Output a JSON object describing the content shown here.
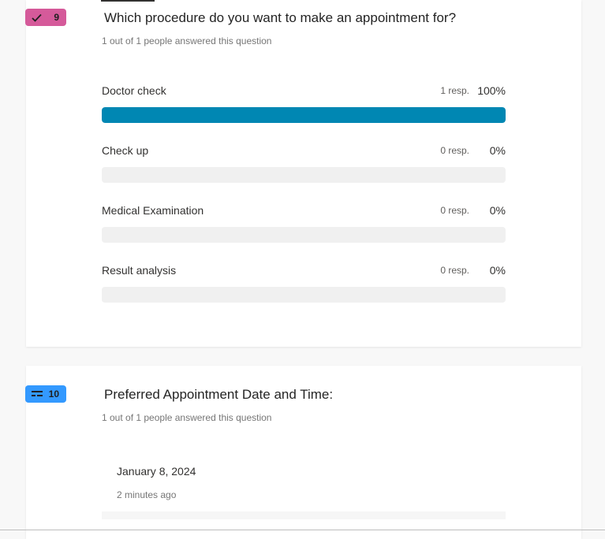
{
  "questions": [
    {
      "number": "9",
      "type_icon": "checkmark-icon",
      "badge_color": "#d55a9a",
      "title": "Which procedure do you want to make an appointment for?",
      "subtitle": "1 out of 1 people answered this question",
      "options": [
        {
          "label": "Doctor check",
          "responses": "1 resp.",
          "percent": "100%",
          "fraction": 1.0
        },
        {
          "label": "Check up",
          "responses": "0 resp.",
          "percent": "0%",
          "fraction": 0.0
        },
        {
          "label": "Medical Examination",
          "responses": "0 resp.",
          "percent": "0%",
          "fraction": 0.0
        },
        {
          "label": "Result analysis",
          "responses": "0 resp.",
          "percent": "0%",
          "fraction": 0.0
        }
      ]
    },
    {
      "number": "10",
      "type_icon": "date-icon",
      "badge_color": "#3399ff",
      "title": "Preferred Appointment Date and Time:",
      "subtitle": "1 out of 1 people answered this question",
      "answers": [
        {
          "value": "January 8, 2024",
          "time": "2 minutes ago"
        }
      ]
    }
  ],
  "colors": {
    "bar_fill": "#0087b3",
    "bar_track": "#f0f0f0"
  }
}
